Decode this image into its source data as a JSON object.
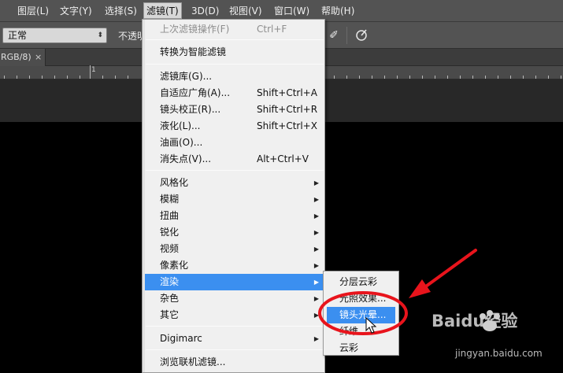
{
  "menubar": {
    "items": [
      {
        "label": "图层(L)"
      },
      {
        "label": "文字(Y)"
      },
      {
        "label": "选择(S)"
      },
      {
        "label": "滤镜(T)"
      },
      {
        "label": "3D(D)"
      },
      {
        "label": "视图(V)"
      },
      {
        "label": "窗口(W)"
      },
      {
        "label": "帮助(H)"
      }
    ]
  },
  "options": {
    "blend_mode": "正常",
    "opacity_label": "不透明"
  },
  "tab": {
    "label": "RGB/8)",
    "close": "×"
  },
  "ruler": {
    "labels": [
      "1"
    ]
  },
  "filter_menu": {
    "items": [
      {
        "label": "上次滤镜操作(F)",
        "shortcut": "Ctrl+F",
        "disabled": true
      },
      {
        "label": "转换为智能滤镜"
      },
      {
        "label": "滤镜库(G)..."
      },
      {
        "label": "自适应广角(A)...",
        "shortcut": "Shift+Ctrl+A"
      },
      {
        "label": "镜头校正(R)...",
        "shortcut": "Shift+Ctrl+R"
      },
      {
        "label": "液化(L)...",
        "shortcut": "Shift+Ctrl+X"
      },
      {
        "label": "油画(O)..."
      },
      {
        "label": "消失点(V)...",
        "shortcut": "Alt+Ctrl+V"
      },
      {
        "label": "风格化",
        "submenu": true
      },
      {
        "label": "模糊",
        "submenu": true
      },
      {
        "label": "扭曲",
        "submenu": true
      },
      {
        "label": "锐化",
        "submenu": true
      },
      {
        "label": "视频",
        "submenu": true
      },
      {
        "label": "像素化",
        "submenu": true
      },
      {
        "label": "渲染",
        "submenu": true,
        "highlighted": true
      },
      {
        "label": "杂色",
        "submenu": true
      },
      {
        "label": "其它",
        "submenu": true
      },
      {
        "label": "Digimarc",
        "submenu": true
      },
      {
        "label": "浏览联机滤镜..."
      }
    ],
    "submenu_arrow": "▶"
  },
  "render_submenu": {
    "items": [
      {
        "label": "分层云彩"
      },
      {
        "label": "光照效果..."
      },
      {
        "label": "镜头光晕...",
        "highlighted": true
      },
      {
        "label": "纤维..."
      },
      {
        "label": "云彩"
      }
    ]
  },
  "watermark": {
    "brand": "Baidu经验",
    "url": "jingyan.baidu.com"
  },
  "colors": {
    "highlight": "#3b8ff0",
    "annotation": "#e8141c"
  }
}
